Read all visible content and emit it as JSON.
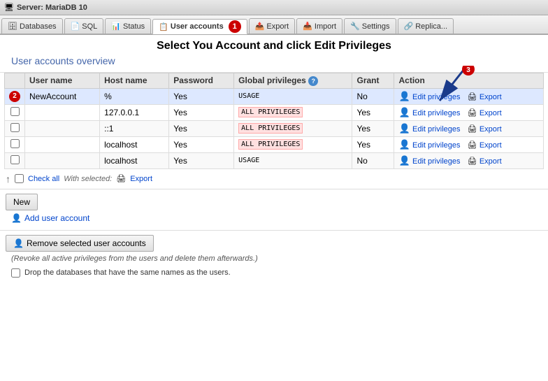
{
  "titlebar": {
    "icon": "🖥",
    "text": "Server: MariaDB 10"
  },
  "tabs": [
    {
      "id": "databases",
      "label": "Databases",
      "icon": "🗄",
      "active": false
    },
    {
      "id": "sql",
      "label": "SQL",
      "icon": "📄",
      "active": false
    },
    {
      "id": "status",
      "label": "Status",
      "icon": "📊",
      "active": false
    },
    {
      "id": "user-accounts",
      "label": "User accounts",
      "icon": "📋",
      "active": true
    },
    {
      "id": "export",
      "label": "Export",
      "icon": "📤",
      "active": false
    },
    {
      "id": "import",
      "label": "Import",
      "icon": "📥",
      "active": false
    },
    {
      "id": "settings",
      "label": "Settings",
      "icon": "🔧",
      "active": false
    },
    {
      "id": "replication",
      "label": "Replica...",
      "icon": "🔗",
      "active": false
    }
  ],
  "instruction": {
    "title": "Select You Account and click Edit Privileges",
    "subtitle": "User accounts overview"
  },
  "table": {
    "headers": [
      "",
      "User name",
      "Host name",
      "Password",
      "Global privileges",
      "",
      "Grant",
      "Action"
    ],
    "rows": [
      {
        "checkbox": true,
        "highlighted": true,
        "step_badge": "2",
        "username": "NewAccount",
        "hostname": "%",
        "password": "Yes",
        "privilege": "USAGE",
        "privilege_type": "usage",
        "grant": "No",
        "action_edit": "Edit privileges",
        "action_export": "Export"
      },
      {
        "checkbox": true,
        "highlighted": false,
        "username": "",
        "hostname": "127.0.0.1",
        "password": "Yes",
        "privilege": "ALL PRIVILEGES",
        "privilege_type": "all",
        "grant": "Yes",
        "action_edit": "Edit privileges",
        "action_export": "Export"
      },
      {
        "checkbox": true,
        "highlighted": false,
        "username": "",
        "hostname": "::1",
        "password": "Yes",
        "privilege": "ALL PRIVILEGES",
        "privilege_type": "all",
        "grant": "Yes",
        "action_edit": "Edit privileges",
        "action_export": "Export"
      },
      {
        "checkbox": true,
        "highlighted": false,
        "username": "",
        "hostname": "localhost",
        "password": "Yes",
        "privilege": "ALL PRIVILEGES",
        "privilege_type": "all",
        "grant": "Yes",
        "action_edit": "Edit privileges",
        "action_export": "Export"
      },
      {
        "checkbox": true,
        "highlighted": false,
        "username": "",
        "hostname": "localhost",
        "password": "Yes",
        "privilege": "USAGE",
        "privilege_type": "usage",
        "grant": "No",
        "action_edit": "Edit privileges",
        "action_export": "Export"
      }
    ]
  },
  "bottom_controls": {
    "check_all_label": "Check all",
    "with_selected_label": "With selected:",
    "export_label": "Export"
  },
  "buttons": {
    "new_label": "New",
    "add_user_label": "Add user account",
    "remove_label": "Remove selected user accounts",
    "remove_note": "(Revoke all active privileges from the users and delete them afterwards.)",
    "drop_checkbox_label": "Drop the databases that have the same names as the users."
  },
  "annotations": {
    "step1_badge": "1",
    "step2_badge": "2",
    "step3_badge": "3"
  },
  "colors": {
    "accent": "#cc0000",
    "link": "#0044cc",
    "header_bg": "#e8e8e8"
  }
}
